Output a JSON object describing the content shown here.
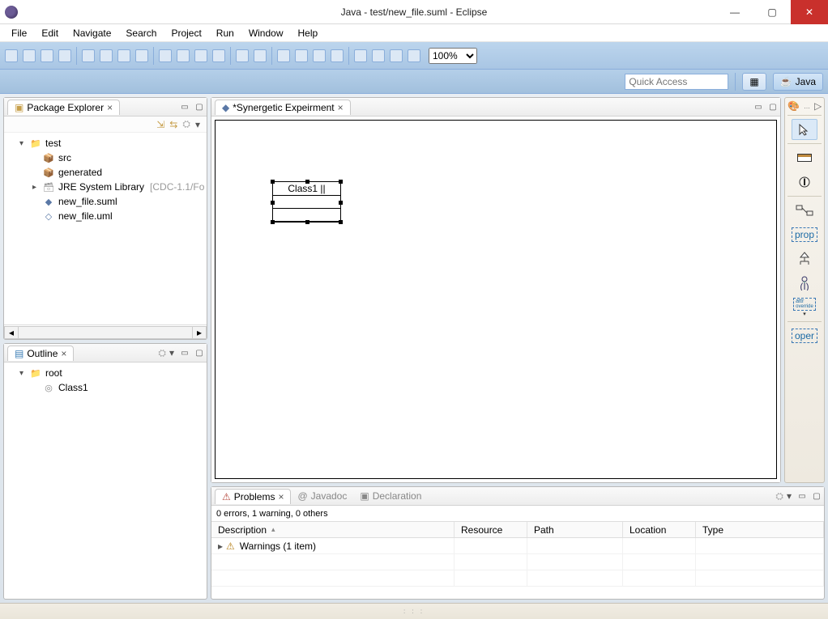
{
  "window": {
    "title": "Java - test/new_file.suml - Eclipse"
  },
  "toolbar": {
    "zoom": "100%",
    "quick_access_placeholder": "Quick Access",
    "perspective": "Java"
  },
  "menu": [
    "File",
    "Edit",
    "Navigate",
    "Search",
    "Project",
    "Run",
    "Window",
    "Help"
  ],
  "package_explorer": {
    "title": "Package Explorer",
    "project": "test",
    "items": {
      "src": "src",
      "generated": "generated",
      "jre": "JRE System Library",
      "jre_hint": "[CDC-1.1/Fo",
      "suml": "new_file.suml",
      "uml": "new_file.uml"
    }
  },
  "outline": {
    "title": "Outline",
    "root": "root",
    "class": "Class1"
  },
  "editor": {
    "tab_title": "*Synergetic Expeirment",
    "class_label": "Class1 ||"
  },
  "palette": {
    "prop": "prop",
    "attr1": "attr",
    "attr2": "override",
    "oper": "oper"
  },
  "problems": {
    "tabs": {
      "problems": "Problems",
      "javadoc": "Javadoc",
      "declaration": "Declaration"
    },
    "summary": "0 errors, 1 warning, 0 others",
    "cols": {
      "desc": "Description",
      "res": "Resource",
      "path": "Path",
      "loc": "Location",
      "type": "Type"
    },
    "rows": [
      {
        "desc": "Warnings (1 item)"
      }
    ]
  }
}
